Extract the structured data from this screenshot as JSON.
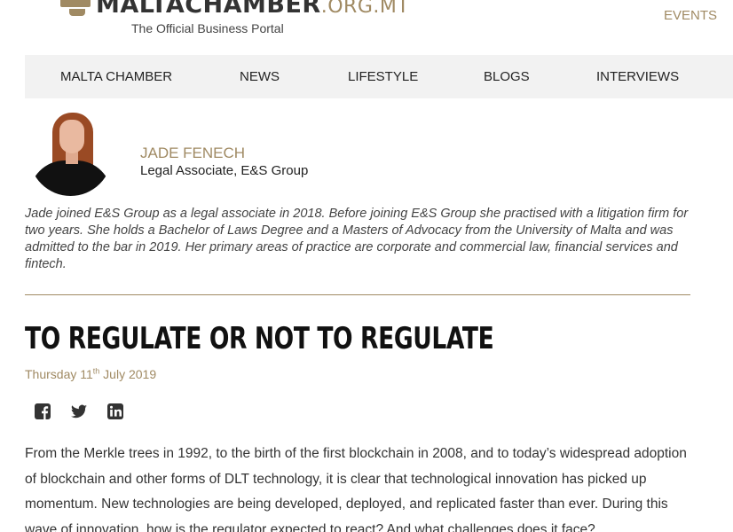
{
  "brand": {
    "name_main": "MALTACHAMBER",
    "name_tld": ".ORG.MT",
    "tagline": "The Official Business Portal"
  },
  "header": {
    "events_label": "EVENTS"
  },
  "nav": {
    "items": [
      {
        "label": "MALTA CHAMBER"
      },
      {
        "label": "NEWS"
      },
      {
        "label": "LIFESTYLE"
      },
      {
        "label": "BLOGS"
      },
      {
        "label": "INTERVIEWS"
      }
    ]
  },
  "author": {
    "name": "JADE FENECH",
    "role": "Legal Associate, E&S Group",
    "bio": "Jade joined E&S Group as a legal associate in 2018. Before joining E&S Group she practised with a litigation firm for two years. She holds a Bachelor of Laws Degree and a Masters of Advocacy from the University of Malta and was admitted to the bar in 2019. Her primary areas of practice are corporate and commercial law, financial services and fintech."
  },
  "article": {
    "title": "TO REGULATE OR NOT TO REGULATE",
    "date_prefix": "Thursday 11",
    "date_suffix": "th",
    "date_rest": " July 2019",
    "body": "From the Merkle trees in 1992, to the birth of the first blockchain in 2008, and to today’s widespread adoption of blockchain and other forms of DLT technology, it is clear that technological innovation has picked up momentum. New technologies are being developed, deployed, and replicated faster than ever. During this wave of innovation, how is the regulator expected to react? And what challenges does it face?"
  },
  "share": {
    "icons": [
      "facebook-icon",
      "twitter-icon",
      "linkedin-icon"
    ]
  },
  "colors": {
    "accent": "#a08a63",
    "nav_bg": "#f2f2f2",
    "text": "#222222"
  }
}
